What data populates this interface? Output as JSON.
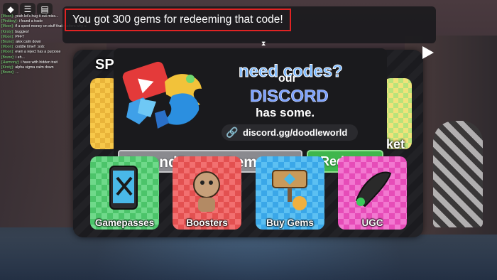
{
  "notification": {
    "text": "You got 300 gems for redeeming that code!"
  },
  "chat": [
    {
      "name": "[Moon]:",
      "text": "yeah let's hug it out miss..."
    },
    {
      "name": "[Pinkboy]:",
      "text": "i found a trade"
    },
    {
      "name": "[Moon]:",
      "text": "if u spent money on stuff that matters why u bothered about my avatar n reject"
    },
    {
      "name": "[Kirsty]:",
      "text": "buggies!"
    },
    {
      "name": "[Moon]:",
      "text": "PFFT"
    },
    {
      "name": "[Bruno]:",
      "text": "alex calm down"
    },
    {
      "name": "[Moon]:",
      "text": "coddle time!! :sob:"
    },
    {
      "name": "[Moon]:",
      "text": "even a reject has a purpose"
    },
    {
      "name": "[Bruno]:",
      "text": "i eh..."
    },
    {
      "name": "[Harmony]:",
      "text": "i have with hidden trait"
    },
    {
      "name": "[Kirsty]:",
      "text": "alpha sigma calm down"
    },
    {
      "name": "[Bruno]:",
      "text": "..."
    }
  ],
  "popup": {
    "heading": "need codes?",
    "our": "our",
    "discord": "DISCORD",
    "has_some": "has some.",
    "link": "discord.gg/doodleworld",
    "code_value": "SecondBuggyGems",
    "redeem_label": "Redeem"
  },
  "side": {
    "left_label": "SP",
    "right_label": "arket"
  },
  "tiles": [
    {
      "label": "Gamepasses"
    },
    {
      "label": "Boosters"
    },
    {
      "label": "Buy Gems"
    },
    {
      "label": "UGC"
    }
  ],
  "icons": {
    "roblox": "roblox-logo-icon",
    "menu": "menu-icon",
    "chat": "chat-icon",
    "link": "link-icon",
    "skip": "play-icon"
  },
  "colors": {
    "redeem": "#3fb64c",
    "highlight": "#e02323",
    "discord": "#7aa0ff"
  }
}
